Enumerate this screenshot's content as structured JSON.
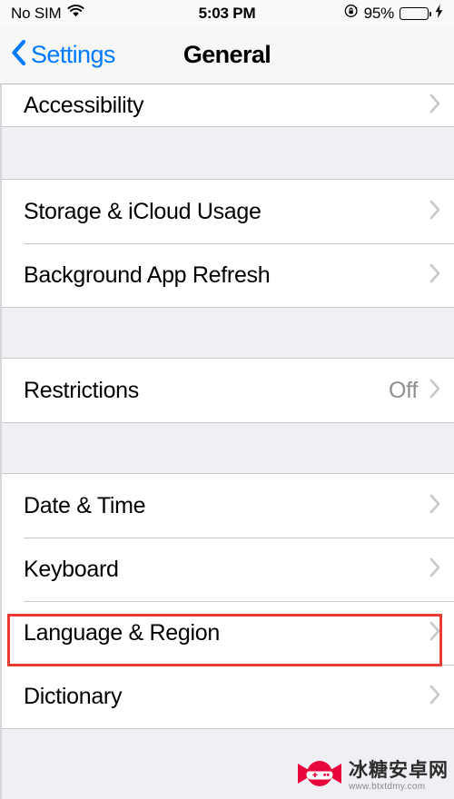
{
  "status_bar": {
    "carrier": "No SIM",
    "wifi_icon": "wifi-icon",
    "time": "5:03 PM",
    "rotation_lock_icon": "rotation-lock-icon",
    "battery_percent": "95%",
    "battery_level": 95,
    "battery_icon": "battery-icon",
    "charging_icon": "lightning-bolt-icon",
    "battery_color": "#4cd964"
  },
  "nav_bar": {
    "back_label": "Settings",
    "back_icon": "chevron-left-icon",
    "title": "General",
    "tint_color": "#007aff"
  },
  "list": {
    "chevron_icon": "chevron-right-icon",
    "highlight_color": "#ec3b33",
    "highlighted_item": "Language & Region",
    "groups": [
      {
        "id": "group-accessibility",
        "clipped_top": true,
        "rows": [
          {
            "label": "Accessibility",
            "value": "",
            "name": "accessibility"
          }
        ]
      },
      {
        "id": "group-storage",
        "clipped_top": false,
        "rows": [
          {
            "label": "Storage & iCloud Usage",
            "value": "",
            "name": "storage-icloud-usage"
          },
          {
            "label": "Background App Refresh",
            "value": "",
            "name": "background-app-refresh"
          }
        ]
      },
      {
        "id": "group-restrictions",
        "clipped_top": false,
        "rows": [
          {
            "label": "Restrictions",
            "value": "Off",
            "name": "restrictions"
          }
        ]
      },
      {
        "id": "group-localization",
        "clipped_top": false,
        "rows": [
          {
            "label": "Date & Time",
            "value": "",
            "name": "date-time"
          },
          {
            "label": "Keyboard",
            "value": "",
            "name": "keyboard"
          },
          {
            "label": "Language & Region",
            "value": "",
            "name": "language-region"
          },
          {
            "label": "Dictionary",
            "value": "",
            "name": "dictionary"
          }
        ]
      }
    ]
  },
  "watermark": {
    "logo_icon": "candy-gamepad-logo-icon",
    "site_name": "冰糖安卓网",
    "url": "www.btxtdmy.com",
    "brand_color": "#e8063c"
  }
}
